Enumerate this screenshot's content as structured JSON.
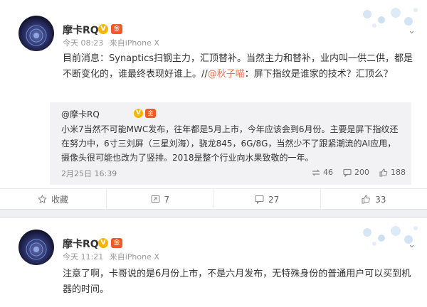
{
  "post1": {
    "username": "摩卡RQ",
    "v_badge": "V",
    "gold_badge": "金",
    "time": "今天 08:23",
    "source_prefix": "来自",
    "source": "iPhone X",
    "text_main": "目前消息：Synaptics扫钢主力，汇顶替补。当然主力和替补，业内叫一供二供，都是不断变化的，谁最终表现好谁上。//",
    "mention": "@秋子喵",
    "text_after": "：屏下指纹是谁家的技术？汇顶么？",
    "repost": {
      "username": "@摩卡RQ",
      "v_badge": "V",
      "gold_badge": "金",
      "text": "小米7当然不可能MWC发布，往年都是5月上市，今年应该会到6月份。主要是屏下指纹还在努力中，6寸三刘屏（三星刘海），骁龙845，6G/8G，当然少不了跟紧潮流的AI应用，摄像头很可能也改为了竖排。2018是整个行业向水果致敬的一年。",
      "time": "2月25日 16:39",
      "stats": {
        "reposts": "46",
        "comments": "200",
        "likes": "188"
      }
    },
    "actions": {
      "favorite": "收藏",
      "repost": "7",
      "comment": "27",
      "like": "33"
    }
  },
  "post2": {
    "username": "摩卡RQ",
    "v_badge": "V",
    "gold_badge": "金",
    "time": "今天 11:21",
    "source_prefix": "来自",
    "source": "iPhone X",
    "text": "注意了啊，卡哥说的是6月份上市，不是六月发布，无特殊身份的普通用户可以买到机器的时间。"
  },
  "colors": {
    "link": "#eb7350",
    "v_badge": "#f7b500",
    "gold_badge": "#f05a28"
  }
}
